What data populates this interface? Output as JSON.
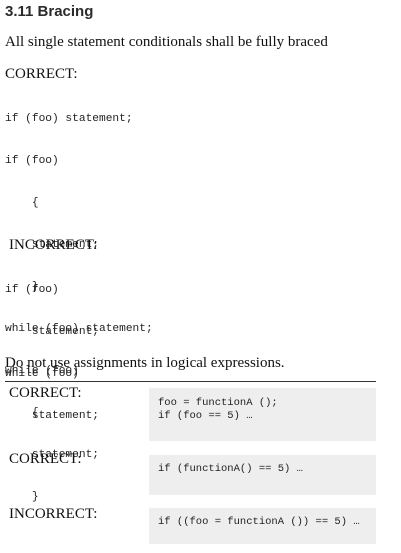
{
  "section": {
    "heading": "3.11 Bracing",
    "intro": "All single statement conditionals shall be fully braced"
  },
  "bracing": {
    "correct_label": "CORRECT:",
    "correct_code": [
      "if (foo) statement;",
      "if (foo)",
      "    {",
      "    statement;",
      "    }",
      "while (foo) statement;",
      "while (foo)",
      "    {",
      "    statement;",
      "    }"
    ],
    "incorrect_label": "INCORRECT:",
    "incorrect_code": [
      "if (foo)",
      "    statement;",
      "while (foo)",
      "    statement;"
    ]
  },
  "assignments": {
    "intro": "Do not use assignments in logical expressions.",
    "rows": [
      {
        "label": "CORRECT:",
        "code": [
          "foo = functionA ();",
          "if (foo == 5) …"
        ]
      },
      {
        "label": "CORRECT:",
        "code": [
          "if (functionA() == 5) …"
        ]
      },
      {
        "label": "INCORRECT:",
        "code": [
          "if ((foo = functionA ()) == 5) …"
        ]
      }
    ]
  }
}
